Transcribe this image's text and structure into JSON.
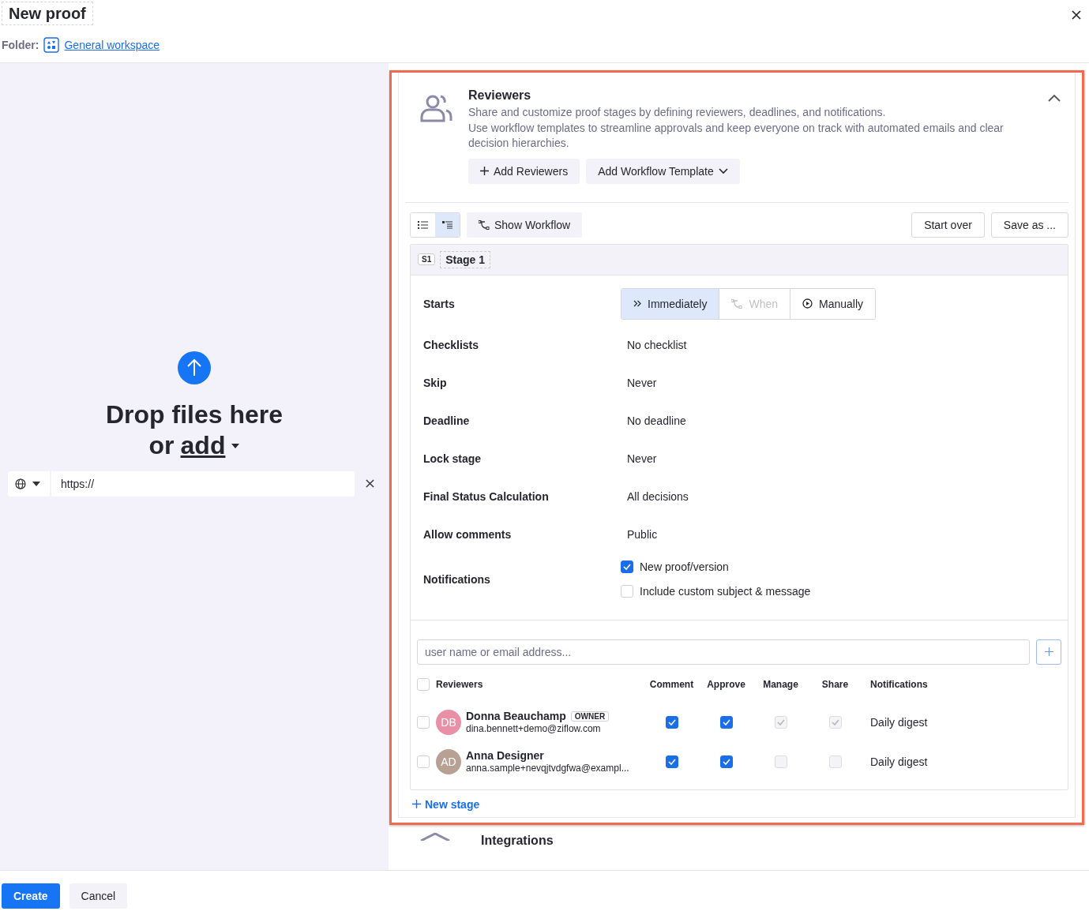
{
  "title": "New proof",
  "folder": {
    "label": "Folder:",
    "link": "General workspace"
  },
  "upload": {
    "heading": "Drop files here",
    "or": "or",
    "add": "add",
    "url_value": "https://"
  },
  "reviewers_section": {
    "title": "Reviewers",
    "expanded": true,
    "description": [
      "Share and customize proof stages by defining reviewers, deadlines, and notifications.",
      "Use workflow templates to streamline approvals and keep everyone on track with automated emails and clear decision hierarchies."
    ],
    "buttons": [
      {
        "kind": "add",
        "label": "Add Reviewers"
      },
      {
        "kind": "dropdown",
        "label": "Add Workflow Template"
      }
    ]
  },
  "toolbar": {
    "view_modes": [
      {
        "kind": "list",
        "selected": false
      },
      {
        "kind": "tree",
        "selected": true
      }
    ],
    "show_workflow": "Show Workflow",
    "actions": [
      "Start over",
      "Save as ..."
    ]
  },
  "stage": {
    "badge": "S1",
    "name": "Stage 1",
    "settings": [
      {
        "kind": "segmented",
        "label": "Starts",
        "options": [
          {
            "label": "Immediately",
            "selected": true,
            "disabled": false
          },
          {
            "label": "When",
            "selected": false,
            "disabled": true
          },
          {
            "label": "Manually",
            "selected": false,
            "disabled": false
          }
        ]
      },
      {
        "kind": "text",
        "label": "Checklists",
        "value": "No checklist"
      },
      {
        "kind": "text",
        "label": "Skip",
        "value": "Never"
      },
      {
        "kind": "text",
        "label": "Deadline",
        "value": "No deadline"
      },
      {
        "kind": "text",
        "label": "Lock stage",
        "value": "Never"
      },
      {
        "kind": "text",
        "label": "Final Status Calculation",
        "value": "All decisions"
      },
      {
        "kind": "text",
        "label": "Allow comments",
        "value": "Public"
      },
      {
        "kind": "checkboxes",
        "label": "Notifications",
        "options": [
          {
            "label": "New proof/version",
            "checked": true
          },
          {
            "label": "Include custom subject & message",
            "checked": false
          }
        ]
      }
    ],
    "search_placeholder": "user name or email address...",
    "columns": [
      "Reviewers",
      "Comment",
      "Approve",
      "Manage",
      "Share",
      "Notifications"
    ],
    "select_all": false,
    "reviewers": [
      {
        "selected": false,
        "initials": "DB",
        "color": "#e98fa6",
        "name": "Donna Beauchamp",
        "badge": "OWNER",
        "email": "dina.bennett+demo@ziflow.com",
        "permissions": [
          {
            "checked": true,
            "disabled": false
          },
          {
            "checked": true,
            "disabled": false
          },
          {
            "checked": true,
            "disabled": true
          },
          {
            "checked": true,
            "disabled": true
          }
        ],
        "notifications": "Daily digest"
      },
      {
        "selected": false,
        "initials": "AD",
        "color": "#b8a194",
        "name": "Anna Designer",
        "email": "anna.sample+nevqjtvdgfwa@exampl...",
        "permissions": [
          {
            "checked": true,
            "disabled": false
          },
          {
            "checked": true,
            "disabled": false
          },
          {
            "checked": false,
            "disabled": true
          },
          {
            "checked": false,
            "disabled": true
          }
        ],
        "notifications": "Daily digest"
      }
    ]
  },
  "new_stage": "New stage",
  "next_section": "Integrations",
  "footer": {
    "primary": "Create",
    "secondary": "Cancel"
  }
}
